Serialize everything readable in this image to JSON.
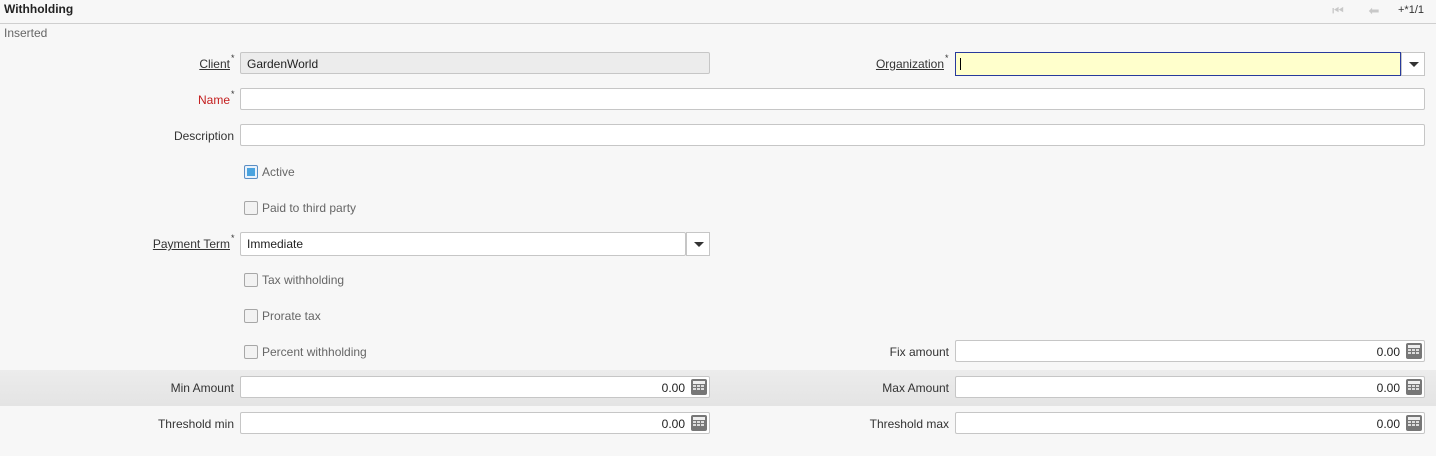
{
  "window": {
    "title": "Withholding",
    "record_counter": "+*1/1"
  },
  "status": "Inserted",
  "form": {
    "client": {
      "label": "Client",
      "value": "GardenWorld"
    },
    "organization": {
      "label": "Organization",
      "value": ""
    },
    "name": {
      "label": "Name",
      "value": ""
    },
    "description": {
      "label": "Description",
      "value": ""
    },
    "active": {
      "label": "Active",
      "checked": true
    },
    "paid_third_party": {
      "label": "Paid to third party",
      "checked": false
    },
    "payment_term": {
      "label": "Payment Term",
      "value": "Immediate"
    },
    "tax_withholding": {
      "label": "Tax withholding",
      "checked": false
    },
    "prorate_tax": {
      "label": "Prorate tax",
      "checked": false
    },
    "percent_withholding": {
      "label": "Percent withholding",
      "checked": false
    },
    "fix_amount": {
      "label": "Fix amount",
      "value": "0.00"
    },
    "min_amount": {
      "label": "Min Amount",
      "value": "0.00"
    },
    "max_amount": {
      "label": "Max Amount",
      "value": "0.00"
    },
    "threshold_min": {
      "label": "Threshold min",
      "value": "0.00"
    },
    "threshold_max": {
      "label": "Threshold max",
      "value": "0.00"
    },
    "mandatory_marker": "*"
  }
}
